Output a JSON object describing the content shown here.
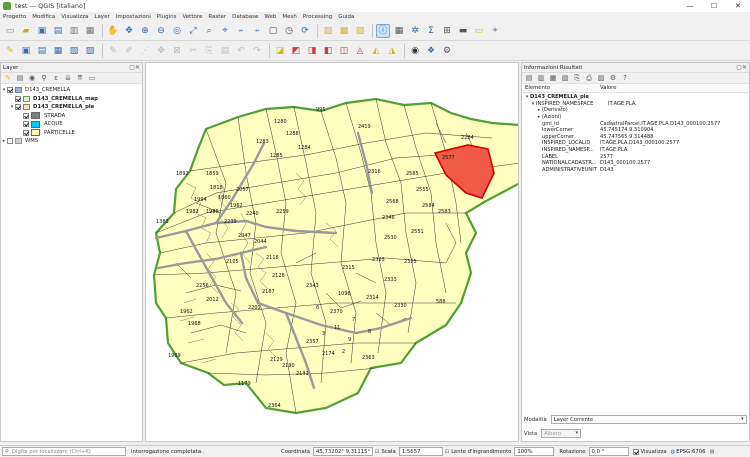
{
  "window": {
    "title": "test — QGIS [italiano]",
    "min": "—",
    "max": "☐",
    "close": "✕"
  },
  "menu": [
    "Progetto",
    "Modifica",
    "Visualizza",
    "Layer",
    "Impostazioni",
    "Plugins",
    "Vettore",
    "Raster",
    "Database",
    "Web",
    "Mesh",
    "Processing",
    "Guida"
  ],
  "layers_panel": {
    "title": "Layer",
    "tree": [
      {
        "label": "D143_CREMELLA",
        "kind": "group"
      },
      {
        "label": "D143_CREMELLA_map",
        "kind": "layer"
      },
      {
        "label": "D143_CREMELLA_ple",
        "kind": "layer"
      },
      {
        "label": "STRADA",
        "kind": "class",
        "color": "#808080"
      },
      {
        "label": "ACQUE",
        "kind": "class",
        "color": "#00c8ff"
      },
      {
        "label": "PARTICELLE",
        "kind": "class",
        "color": "#fffcb4"
      },
      {
        "label": "WMS",
        "kind": "group"
      }
    ]
  },
  "map": {
    "fill_color": "#ffffc0",
    "boundary_color": "#50a032",
    "selected_color": "#f05a46",
    "labels": [
      "2419",
      "2316",
      "2284",
      "2585",
      "2577",
      "2555",
      "2568",
      "2584",
      "2583",
      "2346",
      "2551",
      "2530",
      "2323",
      "2325",
      "2315",
      "2333",
      "2330",
      "2314",
      "2343",
      "2370",
      "2363",
      "2364",
      "2357",
      "2129",
      "2190",
      "2174",
      "2131",
      "1179",
      "2239",
      "2256",
      "2259",
      "2240",
      "1383",
      "1969",
      "1962",
      "1968",
      "2012",
      "1892",
      "1818",
      "1859",
      "2057",
      "1860",
      "1962",
      "1994",
      "1982",
      "1986",
      "2047",
      "588",
      "2044",
      "2118",
      "2187",
      "2201",
      "2105",
      "2128",
      "1096",
      "995",
      "1280",
      "1288",
      "1283",
      "1284",
      "1285",
      "3",
      "11",
      "9",
      "7",
      "8",
      "6",
      "2"
    ]
  },
  "info_panel": {
    "title": "Informazioni Risultati",
    "col_element": "Elemento",
    "col_value": "Valore",
    "layer": "D143_CREMELLA_ple",
    "rows": [
      {
        "key": "INSPIRED_NAMESPACE",
        "value": "IT.AGE.PLA.",
        "indent": 2
      },
      {
        "key": "(Derivato)",
        "value": "",
        "indent": 2
      },
      {
        "key": "(Azioni)",
        "value": "",
        "indent": 2
      },
      {
        "key": "gml_id",
        "value": "CadastralParcel.IT.AGE.PLA.D143_000100.2577",
        "indent": 3
      },
      {
        "key": "lowerCorner",
        "value": "45.745174 9.310904",
        "indent": 3
      },
      {
        "key": "upperCorner",
        "value": "45.747565 9.314488",
        "indent": 3
      },
      {
        "key": "INSPIRED_LOCALID",
        "value": "IT.AGE.PLA.D143_000100.2577",
        "indent": 3
      },
      {
        "key": "INSPIRED_NAMESP...",
        "value": "IT.AGE.PLA.",
        "indent": 3
      },
      {
        "key": "LABEL",
        "value": "2577",
        "indent": 3
      },
      {
        "key": "NATIONALCADASTR...",
        "value": "D143_000100.2577",
        "indent": 3
      },
      {
        "key": "ADMINISTRATIVEUNIT",
        "value": "D143",
        "indent": 3
      }
    ],
    "modality_label": "Modalità",
    "modality_value": "Layer Corrente",
    "view_label": "Vista",
    "view_value": "Albero"
  },
  "status": {
    "locator_placeholder": "Digita per localizzare (Ctrl+K)",
    "message": "Interrogazione completata.",
    "coord_label": "Coordinata",
    "coord_value": "45,73202° 9,31115°",
    "scale_label": "Scala",
    "scale_value": "1:5657",
    "magnifier_label": "Lente d'ingrandimento",
    "magnifier_value": "100%",
    "rotation_label": "Rotazione",
    "rotation_value": "0,0 °",
    "render_label": "Visualizza",
    "crs": "EPSG:6706"
  }
}
